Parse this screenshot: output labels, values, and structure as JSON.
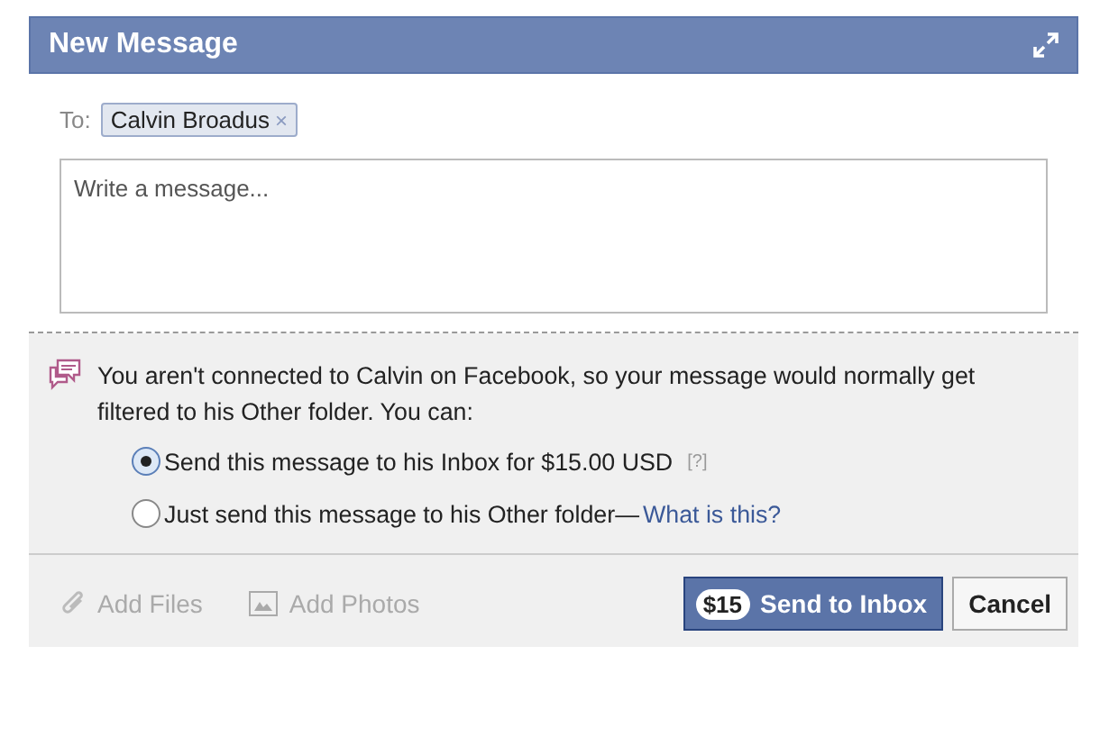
{
  "window": {
    "title": "New Message"
  },
  "to": {
    "label": "To:",
    "recipients": [
      {
        "name": "Calvin Broadus",
        "remove": "×"
      }
    ]
  },
  "message": {
    "placeholder": "Write a message..."
  },
  "notice": {
    "text": "You aren't connected to Calvin on Facebook, so your message would normally get filtered to his Other folder. You can:"
  },
  "options": [
    {
      "label": "Send this message to his Inbox for $15.00 USD",
      "help": "[?]",
      "selected": true
    },
    {
      "label": "Just send this message to his Other folder—",
      "link": "What is this?",
      "selected": false
    }
  ],
  "attachments": [
    {
      "kind": "files",
      "label": "Add Files",
      "disabled": true
    },
    {
      "kind": "photos",
      "label": "Add Photos",
      "disabled": true
    }
  ],
  "send_button": {
    "price": "$15",
    "label": "Send to Inbox"
  },
  "cancel_button": {
    "label": "Cancel"
  }
}
